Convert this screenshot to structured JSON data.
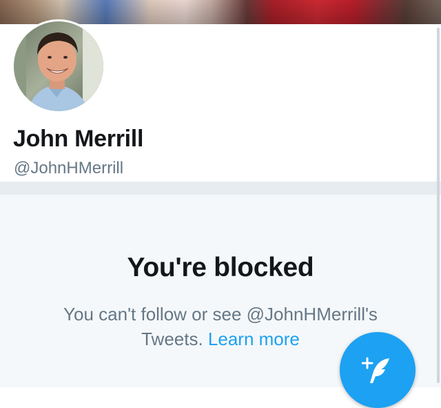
{
  "header": {
    "banner_image": "family-photo-banner",
    "avatar_image": "john-merrill-avatar"
  },
  "profile": {
    "name": "John Merrill",
    "handle": "@JohnHMerrill"
  },
  "blocked": {
    "title": "You're blocked",
    "message_line1": "You can't follow or see @JohnHMerrill's",
    "message_line2": "Tweets.",
    "learn_more": "Learn more"
  },
  "compose": {
    "icon": "compose-tweet-icon"
  },
  "colors": {
    "accent": "#1da1f2",
    "text_primary": "#14171a",
    "text_secondary": "#657786",
    "background_gray": "#f5f8fa",
    "divider": "#e6ecf0"
  }
}
